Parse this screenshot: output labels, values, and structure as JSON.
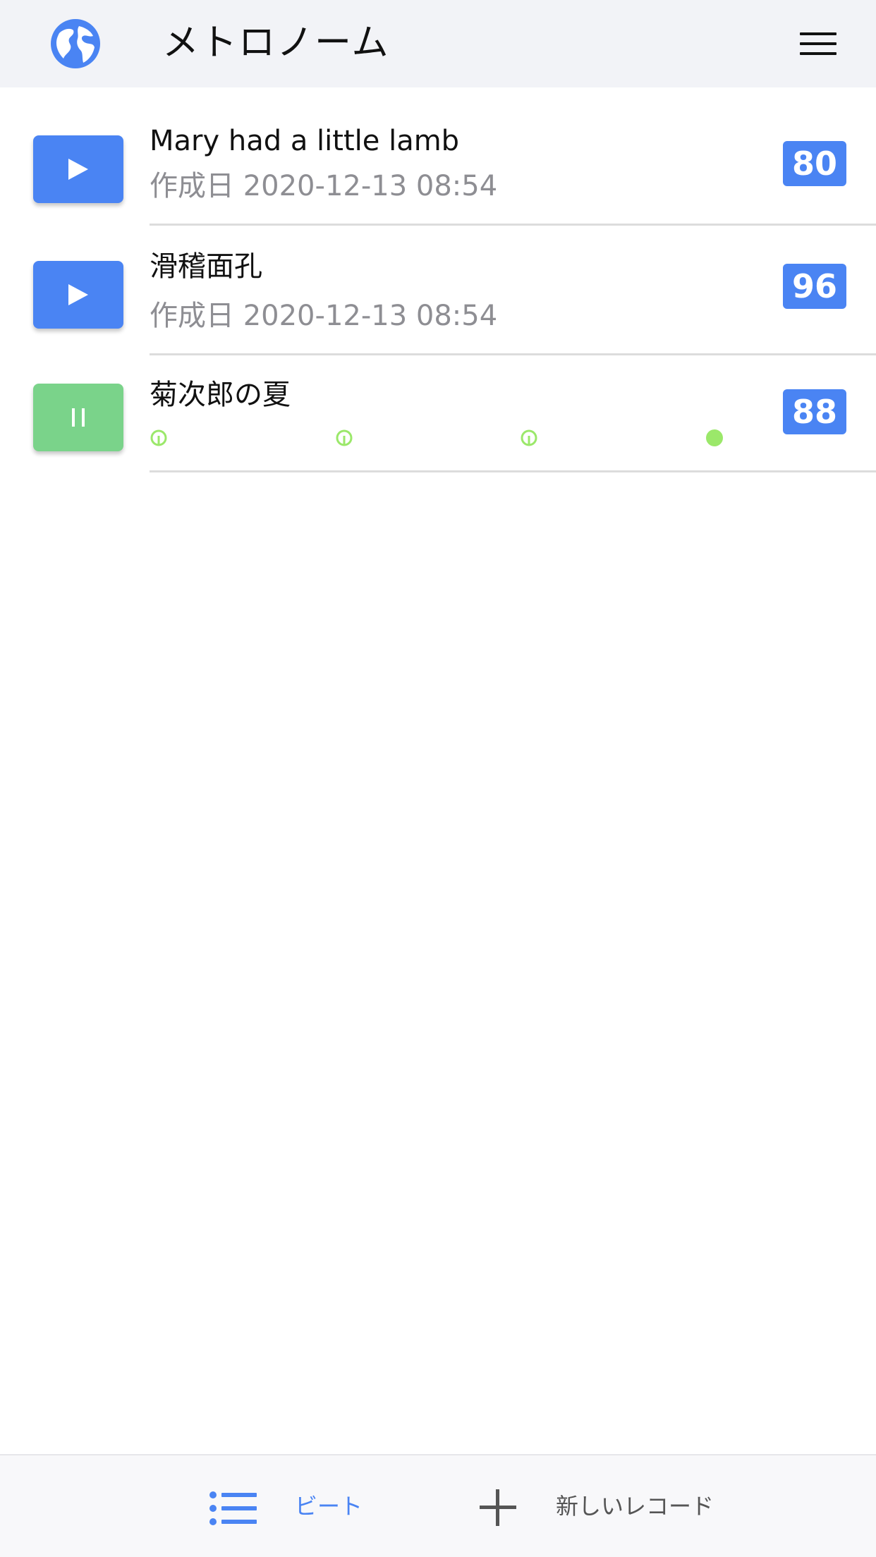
{
  "header": {
    "title": "メトロノーム",
    "icon": "globe-icon",
    "menu_icon": "hamburger-icon"
  },
  "records": [
    {
      "title": "Mary had a little lamb",
      "subtitle": "作成日 2020-12-13 08:54",
      "bpm": "80",
      "state": "stopped"
    },
    {
      "title": "滑稽面孔",
      "subtitle": "作成日 2020-12-13 08:54",
      "bpm": "96",
      "state": "stopped"
    },
    {
      "title": "菊次郎の夏",
      "bpm": "88",
      "state": "playing",
      "beats": 4,
      "active_beat": 4
    }
  ],
  "tabbar": {
    "beats_label": "ビート",
    "new_record_label": "新しいレコード"
  },
  "colors": {
    "accent": "#4a84f3",
    "playing": "#7ad38a",
    "beat_active": "#9be86a",
    "header_bg": "#f2f3f7"
  }
}
